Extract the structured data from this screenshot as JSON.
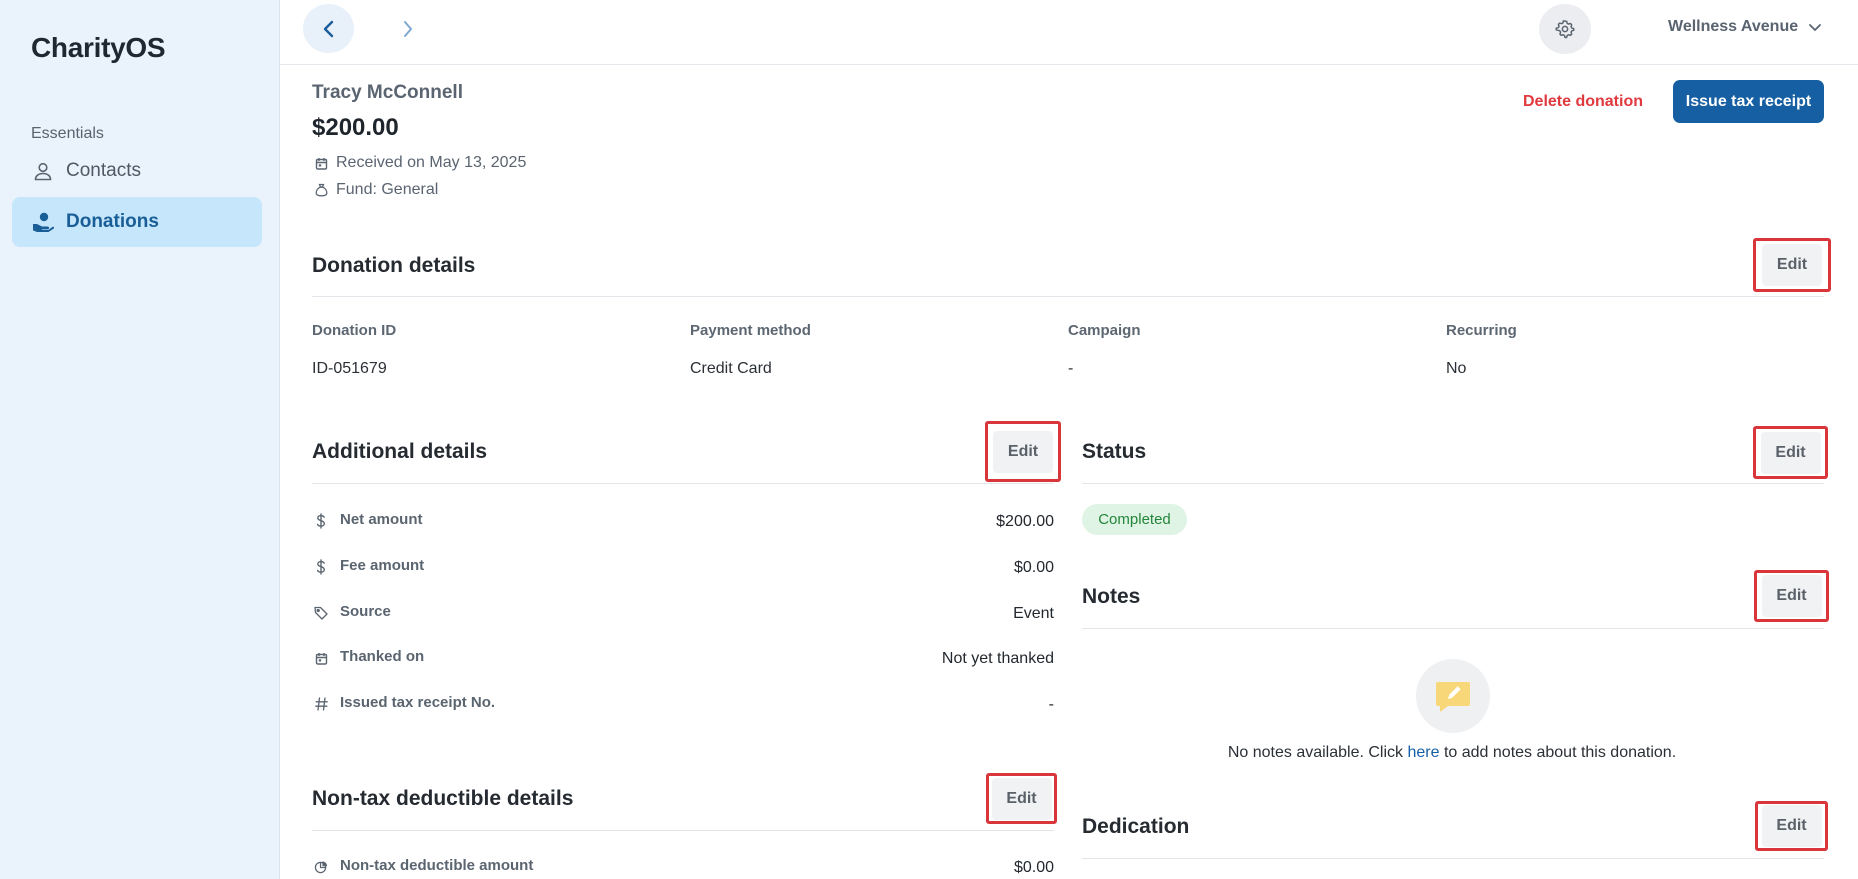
{
  "app": {
    "brand": "CharityOS"
  },
  "sidebar": {
    "section_label": "Essentials",
    "items": [
      {
        "label": "Contacts",
        "icon": "person-icon",
        "active": false
      },
      {
        "label": "Donations",
        "icon": "hand-heart-icon",
        "active": true
      }
    ]
  },
  "topbar": {
    "org_name": "Wellness Avenue"
  },
  "donation": {
    "donor_name": "Tracy McConnell",
    "amount": "$200.00",
    "received": "Received on May 13, 2025",
    "fund": "Fund: General",
    "actions": {
      "delete_label": "Delete donation",
      "issue_label": "Issue tax receipt"
    }
  },
  "details": {
    "title": "Donation details",
    "edit_label": "Edit",
    "columns": [
      {
        "label": "Donation ID",
        "value": "ID-051679"
      },
      {
        "label": "Payment method",
        "value": "Credit Card"
      },
      {
        "label": "Campaign",
        "value": "-"
      },
      {
        "label": "Recurring",
        "value": "No"
      }
    ]
  },
  "additional": {
    "title": "Additional details",
    "edit_label": "Edit",
    "rows": [
      {
        "icon": "dollar-icon",
        "label": "Net amount",
        "value": "$200.00"
      },
      {
        "icon": "dollar-icon",
        "label": "Fee amount",
        "value": "$0.00"
      },
      {
        "icon": "tag-icon",
        "label": "Source",
        "value": "Event"
      },
      {
        "icon": "calendar-icon",
        "label": "Thanked on",
        "value": "Not yet thanked"
      },
      {
        "icon": "hash-icon",
        "label": "Issued tax receipt No.",
        "value": "-"
      }
    ]
  },
  "nontax": {
    "title": "Non-tax deductible details",
    "edit_label": "Edit",
    "rows": [
      {
        "icon": "pie-chart-icon",
        "label": "Non-tax deductible amount",
        "value": "$0.00"
      }
    ]
  },
  "status": {
    "title": "Status",
    "edit_label": "Edit",
    "badge": "Completed",
    "badge_color": "#23853b"
  },
  "notes": {
    "title": "Notes",
    "edit_label": "Edit",
    "empty_prefix": "No notes available. Click ",
    "empty_link": "here",
    "empty_suffix": " to add notes about this donation."
  },
  "dedication": {
    "title": "Dedication",
    "edit_label": "Edit"
  },
  "colors": {
    "accent": "#155fa2",
    "danger": "#e0393e",
    "sidebar_bg": "#eaf3fb",
    "active_nav_bg": "#c5e6fb",
    "highlight": "#d8363a"
  }
}
